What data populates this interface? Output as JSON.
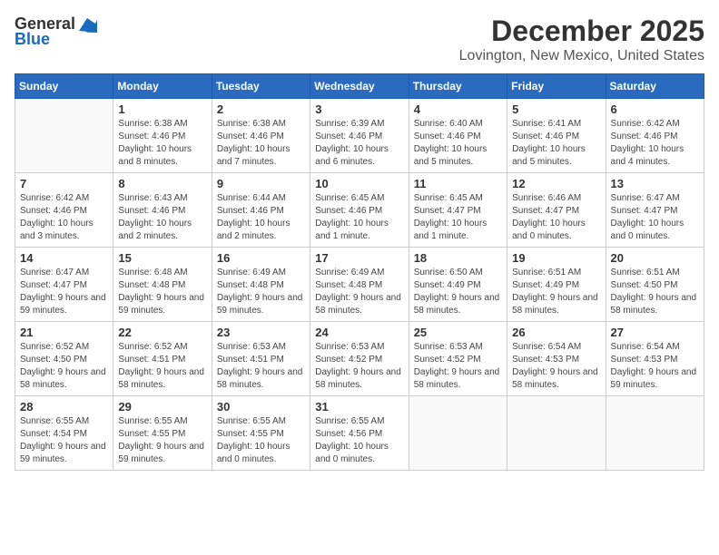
{
  "header": {
    "logo_general": "General",
    "logo_blue": "Blue",
    "month": "December 2025",
    "location": "Lovington, New Mexico, United States"
  },
  "days_of_week": [
    "Sunday",
    "Monday",
    "Tuesday",
    "Wednesday",
    "Thursday",
    "Friday",
    "Saturday"
  ],
  "weeks": [
    [
      {
        "day": "",
        "sunrise": "",
        "sunset": "",
        "daylight": "",
        "empty": true
      },
      {
        "day": "1",
        "sunrise": "Sunrise: 6:38 AM",
        "sunset": "Sunset: 4:46 PM",
        "daylight": "Daylight: 10 hours and 8 minutes."
      },
      {
        "day": "2",
        "sunrise": "Sunrise: 6:38 AM",
        "sunset": "Sunset: 4:46 PM",
        "daylight": "Daylight: 10 hours and 7 minutes."
      },
      {
        "day": "3",
        "sunrise": "Sunrise: 6:39 AM",
        "sunset": "Sunset: 4:46 PM",
        "daylight": "Daylight: 10 hours and 6 minutes."
      },
      {
        "day": "4",
        "sunrise": "Sunrise: 6:40 AM",
        "sunset": "Sunset: 4:46 PM",
        "daylight": "Daylight: 10 hours and 5 minutes."
      },
      {
        "day": "5",
        "sunrise": "Sunrise: 6:41 AM",
        "sunset": "Sunset: 4:46 PM",
        "daylight": "Daylight: 10 hours and 5 minutes."
      },
      {
        "day": "6",
        "sunrise": "Sunrise: 6:42 AM",
        "sunset": "Sunset: 4:46 PM",
        "daylight": "Daylight: 10 hours and 4 minutes."
      }
    ],
    [
      {
        "day": "7",
        "sunrise": "Sunrise: 6:42 AM",
        "sunset": "Sunset: 4:46 PM",
        "daylight": "Daylight: 10 hours and 3 minutes."
      },
      {
        "day": "8",
        "sunrise": "Sunrise: 6:43 AM",
        "sunset": "Sunset: 4:46 PM",
        "daylight": "Daylight: 10 hours and 2 minutes."
      },
      {
        "day": "9",
        "sunrise": "Sunrise: 6:44 AM",
        "sunset": "Sunset: 4:46 PM",
        "daylight": "Daylight: 10 hours and 2 minutes."
      },
      {
        "day": "10",
        "sunrise": "Sunrise: 6:45 AM",
        "sunset": "Sunset: 4:46 PM",
        "daylight": "Daylight: 10 hours and 1 minute."
      },
      {
        "day": "11",
        "sunrise": "Sunrise: 6:45 AM",
        "sunset": "Sunset: 4:47 PM",
        "daylight": "Daylight: 10 hours and 1 minute."
      },
      {
        "day": "12",
        "sunrise": "Sunrise: 6:46 AM",
        "sunset": "Sunset: 4:47 PM",
        "daylight": "Daylight: 10 hours and 0 minutes."
      },
      {
        "day": "13",
        "sunrise": "Sunrise: 6:47 AM",
        "sunset": "Sunset: 4:47 PM",
        "daylight": "Daylight: 10 hours and 0 minutes."
      }
    ],
    [
      {
        "day": "14",
        "sunrise": "Sunrise: 6:47 AM",
        "sunset": "Sunset: 4:47 PM",
        "daylight": "Daylight: 9 hours and 59 minutes."
      },
      {
        "day": "15",
        "sunrise": "Sunrise: 6:48 AM",
        "sunset": "Sunset: 4:48 PM",
        "daylight": "Daylight: 9 hours and 59 minutes."
      },
      {
        "day": "16",
        "sunrise": "Sunrise: 6:49 AM",
        "sunset": "Sunset: 4:48 PM",
        "daylight": "Daylight: 9 hours and 59 minutes."
      },
      {
        "day": "17",
        "sunrise": "Sunrise: 6:49 AM",
        "sunset": "Sunset: 4:48 PM",
        "daylight": "Daylight: 9 hours and 58 minutes."
      },
      {
        "day": "18",
        "sunrise": "Sunrise: 6:50 AM",
        "sunset": "Sunset: 4:49 PM",
        "daylight": "Daylight: 9 hours and 58 minutes."
      },
      {
        "day": "19",
        "sunrise": "Sunrise: 6:51 AM",
        "sunset": "Sunset: 4:49 PM",
        "daylight": "Daylight: 9 hours and 58 minutes."
      },
      {
        "day": "20",
        "sunrise": "Sunrise: 6:51 AM",
        "sunset": "Sunset: 4:50 PM",
        "daylight": "Daylight: 9 hours and 58 minutes."
      }
    ],
    [
      {
        "day": "21",
        "sunrise": "Sunrise: 6:52 AM",
        "sunset": "Sunset: 4:50 PM",
        "daylight": "Daylight: 9 hours and 58 minutes."
      },
      {
        "day": "22",
        "sunrise": "Sunrise: 6:52 AM",
        "sunset": "Sunset: 4:51 PM",
        "daylight": "Daylight: 9 hours and 58 minutes."
      },
      {
        "day": "23",
        "sunrise": "Sunrise: 6:53 AM",
        "sunset": "Sunset: 4:51 PM",
        "daylight": "Daylight: 9 hours and 58 minutes."
      },
      {
        "day": "24",
        "sunrise": "Sunrise: 6:53 AM",
        "sunset": "Sunset: 4:52 PM",
        "daylight": "Daylight: 9 hours and 58 minutes."
      },
      {
        "day": "25",
        "sunrise": "Sunrise: 6:53 AM",
        "sunset": "Sunset: 4:52 PM",
        "daylight": "Daylight: 9 hours and 58 minutes."
      },
      {
        "day": "26",
        "sunrise": "Sunrise: 6:54 AM",
        "sunset": "Sunset: 4:53 PM",
        "daylight": "Daylight: 9 hours and 58 minutes."
      },
      {
        "day": "27",
        "sunrise": "Sunrise: 6:54 AM",
        "sunset": "Sunset: 4:53 PM",
        "daylight": "Daylight: 9 hours and 59 minutes."
      }
    ],
    [
      {
        "day": "28",
        "sunrise": "Sunrise: 6:55 AM",
        "sunset": "Sunset: 4:54 PM",
        "daylight": "Daylight: 9 hours and 59 minutes."
      },
      {
        "day": "29",
        "sunrise": "Sunrise: 6:55 AM",
        "sunset": "Sunset: 4:55 PM",
        "daylight": "Daylight: 9 hours and 59 minutes."
      },
      {
        "day": "30",
        "sunrise": "Sunrise: 6:55 AM",
        "sunset": "Sunset: 4:55 PM",
        "daylight": "Daylight: 10 hours and 0 minutes."
      },
      {
        "day": "31",
        "sunrise": "Sunrise: 6:55 AM",
        "sunset": "Sunset: 4:56 PM",
        "daylight": "Daylight: 10 hours and 0 minutes."
      },
      {
        "day": "",
        "sunrise": "",
        "sunset": "",
        "daylight": "",
        "empty": true
      },
      {
        "day": "",
        "sunrise": "",
        "sunset": "",
        "daylight": "",
        "empty": true
      },
      {
        "day": "",
        "sunrise": "",
        "sunset": "",
        "daylight": "",
        "empty": true
      }
    ]
  ]
}
